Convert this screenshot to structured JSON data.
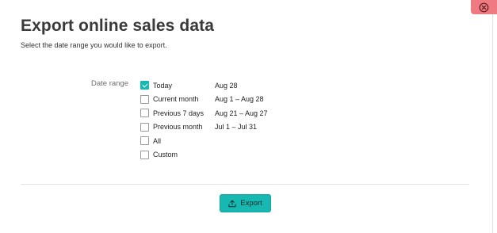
{
  "dialog": {
    "title": "Export online sales data",
    "subtitle": "Select the date range you would like to export.",
    "close_icon": "close-icon"
  },
  "date_range": {
    "label": "Date range",
    "options": [
      {
        "label": "Today",
        "range": "Aug 28",
        "checked": true
      },
      {
        "label": "Current month",
        "range": "Aug 1 – Aug 28",
        "checked": false
      },
      {
        "label": "Previous 7 days",
        "range": "Aug 21 – Aug 27",
        "checked": false
      },
      {
        "label": "Previous month",
        "range": "Jul 1 – Jul 31",
        "checked": false
      },
      {
        "label": "All",
        "range": "",
        "checked": false
      },
      {
        "label": "Custom",
        "range": "",
        "checked": false
      }
    ]
  },
  "footer": {
    "export_label": "Export",
    "export_icon": "upload-icon"
  },
  "colors": {
    "accent": "#17b8b2",
    "close_bg": "#f07a82"
  }
}
